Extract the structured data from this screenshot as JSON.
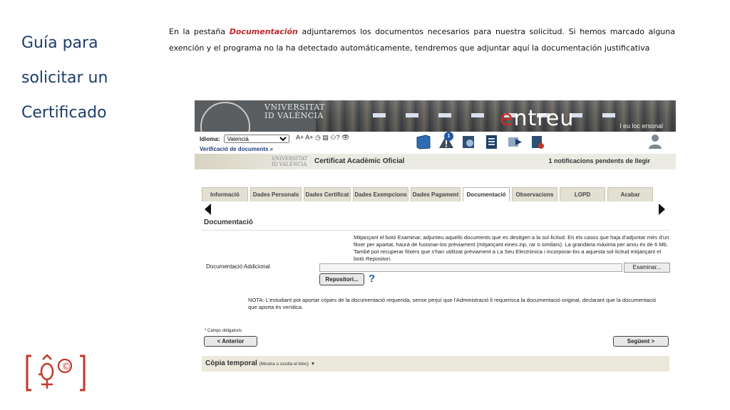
{
  "slide": {
    "title_lines": [
      "Guía para",
      "solicitar un",
      "Certificado"
    ],
    "intro_prefix": "En la pestaña ",
    "intro_em": "Documentación",
    "intro_suffix": " adjuntaremos los documentos necesarios para nuestra solicitud. Si hemos marcado alguna exención y el programa no la ha detectado automáticamente, tendremos que adjuntar aquí la documentación justificativa",
    "logo_symbol": "©"
  },
  "app": {
    "banner": {
      "university_line1": "VNIVERSITAT",
      "university_line2": "ID VALÈNCIA",
      "brand_prefix": "e",
      "brand_rest": "ntreu",
      "personal_link": "l eu loc ersonal"
    },
    "toolbar": {
      "language_label": "Idioma:",
      "language_value": "Valencià",
      "verify_label": "Verificació de documents",
      "mini_tools": "A+ A+ ◷ ▤ ⚇? 👁",
      "notification_badge": "1"
    },
    "subbanner": {
      "uv_line1": "VNIVERSITAT",
      "uv_line2": "ID VALÈNCIA",
      "title": "Certificat Acadèmic Oficial",
      "notifications": "1 notificacions pendents de llegir"
    },
    "tabs": [
      {
        "label": "Informació"
      },
      {
        "label": "Dades Personals"
      },
      {
        "label": "Dades Certificat"
      },
      {
        "label": "Dades Exempcions"
      },
      {
        "label": "Dades Pagament"
      },
      {
        "label": "Documentació"
      },
      {
        "label": "Observacions"
      },
      {
        "label": "LOPD"
      },
      {
        "label": "Acabar"
      }
    ],
    "active_tab": "Documentació",
    "panel": {
      "title": "Documentació",
      "help_text": "Mitjançant el botó Examinar, adjunteu aquells documents que es desitgen a la sol·licitud. En els casos que haja d'adjuntar més d'un fitxer per apartat, haurà de fusionar-los prèviament (mitjançant eines zip, rar o similars). La grandària màxima per arxiu és de 6 Mb. També pot recuperar fitxers que s'han utilitzat prèviament a La Seu Electrònica i incorporar-los a aquesta sol·licitud mitjançant el botó Repositori.",
      "field_label": "Documentació Addicional",
      "browse_label": "Examinar...",
      "repo_label": "Repositori...",
      "help_icon": "?",
      "note": "NOTA: L'estudiant pot aportar còpies de la documentació requerida, sense perjuí que l'Administració li requerisca la documentació original, declarant que la documentació que aporta és verídica.",
      "required_note": "* Camps obligatoris",
      "prev_label": "< Anterior",
      "next_label": "Següent >"
    },
    "copy_bar": {
      "title": "Còpia temporal",
      "subtitle": "(Mostra o oculta el bloc)",
      "caret": "▼"
    }
  },
  "colors": {
    "title_blue": "#1d3d6a",
    "accent_red": "#c0282d",
    "tab_bg": "#e2dfd3"
  }
}
